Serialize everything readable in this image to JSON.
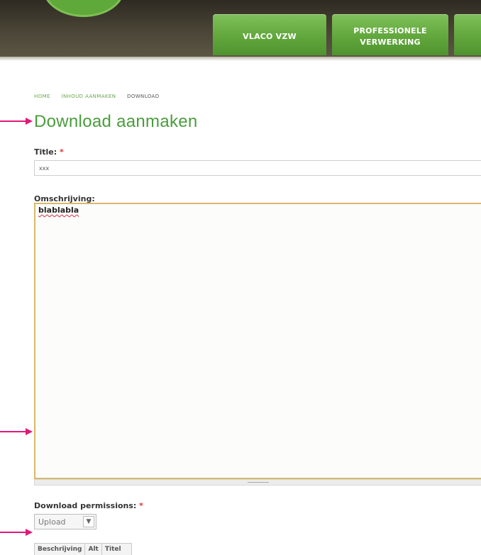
{
  "nav": {
    "tabs": [
      {
        "label": "VLACO VZW"
      },
      {
        "label": "PROFESSIONELE\nVERWERKING"
      },
      {
        "label": ""
      }
    ]
  },
  "breadcrumb": [
    "HOME",
    "INHOUD AANMAKEN",
    "DOWNLOAD"
  ],
  "page": {
    "title": "Download aanmaken"
  },
  "form": {
    "title_label": "Title:",
    "title_value": "xxx",
    "description_label": "Omschrijving:",
    "description_value": "blablabla",
    "permissions_label": "Download permissions:",
    "permissions_value": "Upload",
    "required_mark": "*"
  },
  "table": {
    "headers": [
      "Beschrijving",
      "Alt",
      "Titel"
    ]
  },
  "colors": {
    "accent_green": "#4a9d3c",
    "annotation_arrow": "#e0197a"
  },
  "icons": {
    "annotation": "arrow-right-icon",
    "select": "chevron-down-icon"
  }
}
